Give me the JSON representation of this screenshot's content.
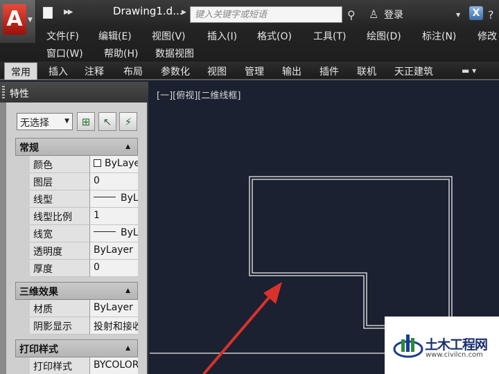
{
  "titlebar": {
    "app_logo": "A",
    "document_title": "Drawing1.d...",
    "search_placeholder": "键入关键字或短语",
    "login": "登录",
    "icons": [
      "app-logo-icon",
      "new-file-icon",
      "binoculars-icon",
      "user-icon",
      "exchange-icon",
      "help-icon"
    ]
  },
  "menubar": {
    "row1": [
      "文件(F)",
      "编辑(E)",
      "视图(V)",
      "插入(I)",
      "格式(O)",
      "工具(T)",
      "绘图(D)",
      "标注(N)",
      "修改"
    ],
    "row2": [
      "窗口(W)",
      "帮助(H)",
      "数据视图"
    ]
  },
  "ribbon": {
    "tabs": [
      "常用",
      "插入",
      "注释",
      "布局",
      "参数化",
      "视图",
      "管理",
      "输出",
      "插件",
      "联机",
      "天正建筑"
    ],
    "active_tab": "常用"
  },
  "properties": {
    "title": "特性",
    "selection": "无选择",
    "sections": [
      {
        "title": "常规",
        "rows": [
          {
            "label": "颜色",
            "value": "ByLayer"
          },
          {
            "label": "图层",
            "value": "0"
          },
          {
            "label": "线型",
            "value": "ByLa..."
          },
          {
            "label": "线型比例",
            "value": "1"
          },
          {
            "label": "线宽",
            "value": "ByLa..."
          },
          {
            "label": "透明度",
            "value": "ByLayer"
          },
          {
            "label": "厚度",
            "value": "0"
          }
        ]
      },
      {
        "title": "三维效果",
        "rows": [
          {
            "label": "材质",
            "value": "ByLayer"
          },
          {
            "label": "阴影显示",
            "value": "投射和接收..."
          }
        ]
      },
      {
        "title": "打印样式",
        "rows": [
          {
            "label": "打印样式",
            "value": "BYCOLOR"
          }
        ]
      }
    ]
  },
  "viewport": {
    "label": "[一][俯视][二维线框]",
    "background_color": "#1b2130",
    "line_color": "#f0f0f0",
    "arrow_color": "#d9312b"
  },
  "watermark": {
    "title": "土木工程网",
    "url": "www.civilcn.com"
  }
}
